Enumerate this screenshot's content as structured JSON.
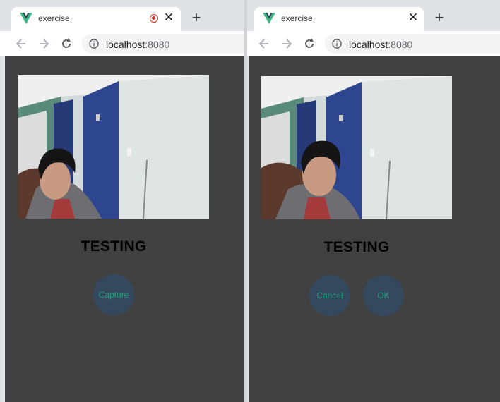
{
  "left_window": {
    "tab": {
      "title": "exercise",
      "close_icon": "close-icon",
      "recording_icon": "recording-icon"
    },
    "address": {
      "host": "localhost",
      "port": ":8080"
    },
    "page": {
      "heading": "TESTING",
      "capture_label": "Capture"
    }
  },
  "right_window": {
    "tab": {
      "title": "exercise",
      "close_icon": "close-icon"
    },
    "address": {
      "host": "localhost",
      "port": ":8080"
    },
    "page": {
      "heading": "TESTING",
      "cancel_label": "Cancel",
      "ok_label": "OK"
    }
  },
  "colors": {
    "page_background": "#414141",
    "button_background": "#34495e",
    "button_text": "#1e9e7a",
    "favicon": "#41b883",
    "recording": "#d93025"
  },
  "icons": [
    "vue-logo-icon",
    "recording-icon",
    "close-icon",
    "new-tab-icon",
    "back-arrow-icon",
    "forward-arrow-icon",
    "reload-icon",
    "info-icon"
  ]
}
